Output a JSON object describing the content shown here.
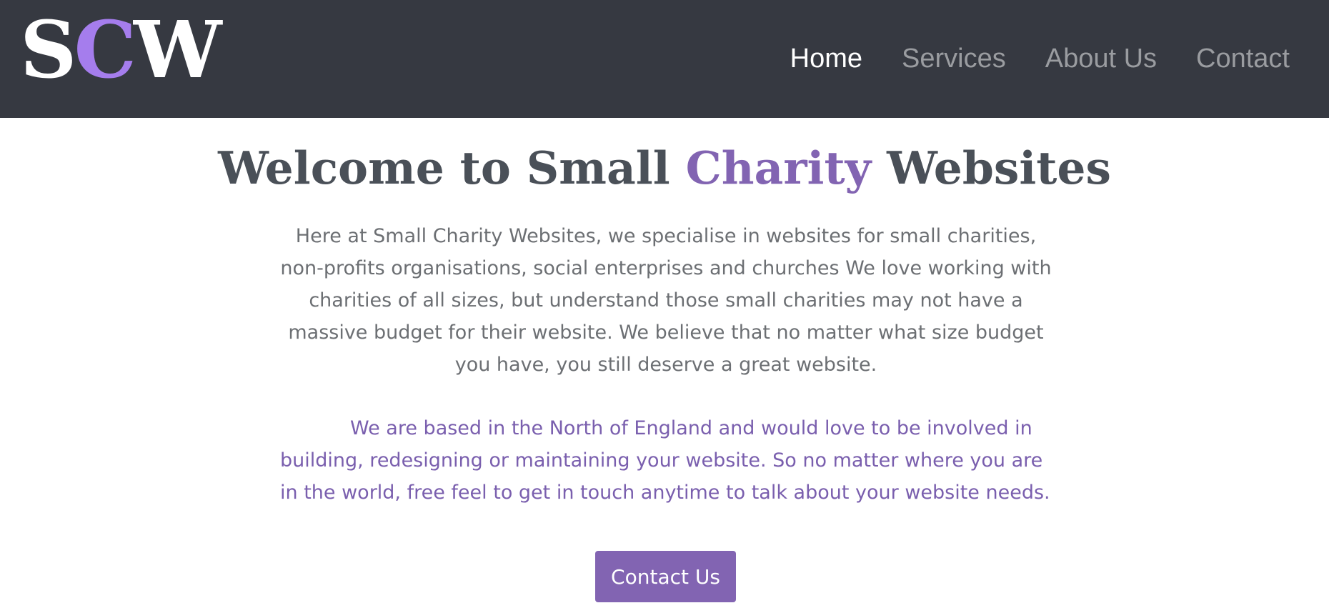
{
  "colors": {
    "header_bg": "#363941",
    "accent": "#8264b2",
    "logo_accent": "#a57ded",
    "heading": "#4a5058",
    "body_text": "#6c6f73"
  },
  "header": {
    "logo": {
      "letters": [
        "S",
        "C",
        "W"
      ]
    },
    "nav": [
      {
        "label": "Home",
        "active": true
      },
      {
        "label": "Services",
        "active": false
      },
      {
        "label": "About Us",
        "active": false
      },
      {
        "label": "Contact",
        "active": false
      }
    ]
  },
  "main": {
    "title": {
      "part1": "Welcome to Small ",
      "highlight": "Charity",
      "part2": " Websites"
    },
    "intro": "Here at Small Charity Websites, we specialise in websites for small charities, non-profits organisations, social enterprises and churches We love working with charities of all sizes, but understand those small charities may not have a massive budget for their website. We believe that no matter what size budget you have, you still deserve a great website.",
    "location": "We are based in the North of England and would love to be involved in building, redesigning or maintaining your website. So no matter where you are in the world, free feel to get in touch anytime to talk about your website needs.",
    "cta_label": "Contact Us"
  }
}
